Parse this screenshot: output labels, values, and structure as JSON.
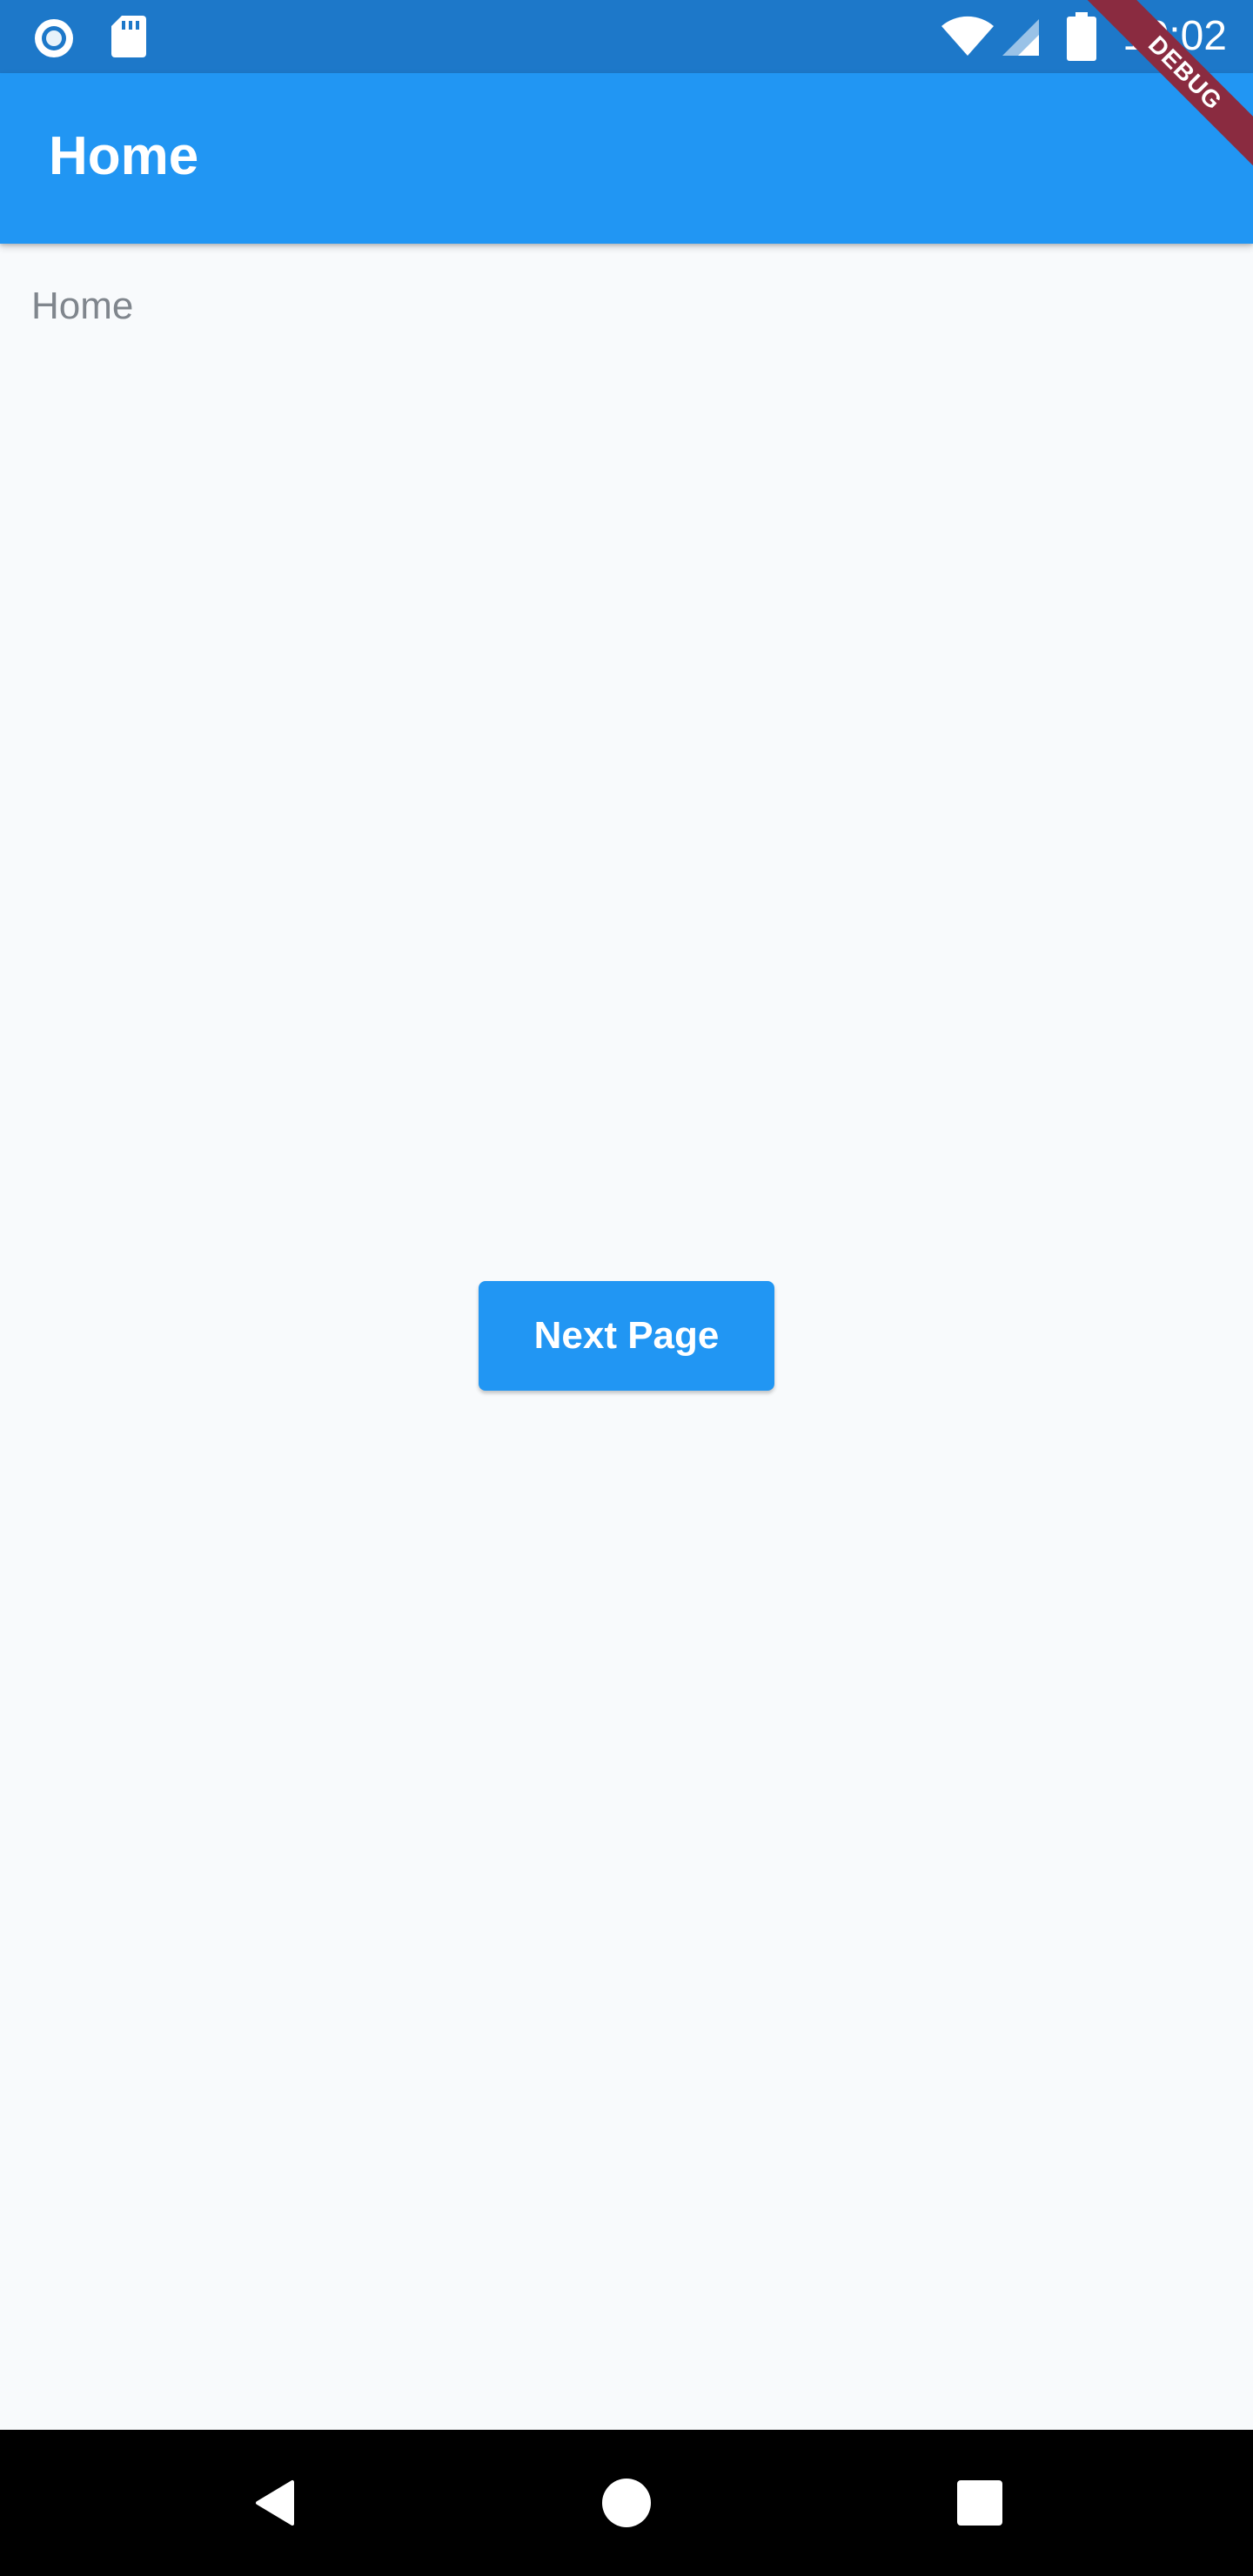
{
  "status_bar": {
    "time": "10:02",
    "icons": [
      "circle-notification-icon",
      "sd-card-icon",
      "wifi-icon",
      "signal-icon",
      "battery-icon"
    ]
  },
  "app_bar": {
    "title": "Home",
    "background_color": "#2196f3"
  },
  "debug_banner": {
    "label": "DEBUG"
  },
  "main": {
    "text": "Home",
    "next_button_label": "Next Page"
  },
  "nav_bar": {
    "icons": [
      "back-icon",
      "home-icon",
      "recents-icon"
    ]
  },
  "colors": {
    "status_bar": "#1d78c9",
    "primary": "#2196f3",
    "background": "#f8fafc",
    "body_text": "#80868d"
  }
}
